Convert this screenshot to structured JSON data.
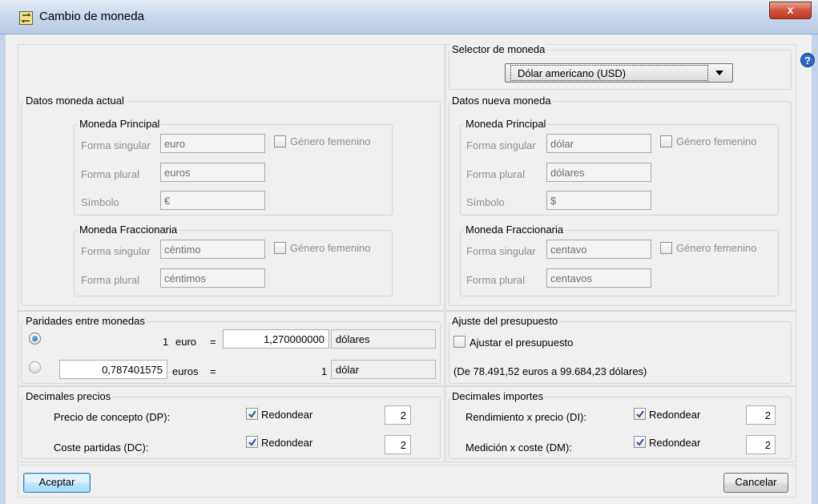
{
  "window": {
    "title": "Cambio de moneda",
    "close_label": "x",
    "help_label": "?"
  },
  "selector": {
    "legend": "Selector de moneda",
    "selected": "Dólar americano (USD)"
  },
  "current": {
    "legend": "Datos moneda actual",
    "principal": {
      "legend": "Moneda Principal",
      "singular_label": "Forma singular",
      "singular_value": "euro",
      "plural_label": "Forma plural",
      "plural_value": "euros",
      "symbol_label": "Símbolo",
      "symbol_value": "€",
      "gender_label": "Género femenino"
    },
    "fraction": {
      "legend": "Moneda Fraccionaria",
      "singular_label": "Forma singular",
      "singular_value": "céntimo",
      "plural_label": "Forma plural",
      "plural_value": "céntimos",
      "gender_label": "Género femenino"
    }
  },
  "new": {
    "legend": "Datos nueva moneda",
    "principal": {
      "legend": "Moneda Principal",
      "singular_label": "Forma singular",
      "singular_value": "dólar",
      "plural_label": "Forma plural",
      "plural_value": "dólares",
      "symbol_label": "Símbolo",
      "symbol_value": "$",
      "gender_label": "Género femenino"
    },
    "fraction": {
      "legend": "Moneda Fraccionaria",
      "singular_label": "Forma singular",
      "singular_value": "centavo",
      "plural_label": "Forma plural",
      "plural_value": "centavos",
      "gender_label": "Género femenino"
    }
  },
  "parity": {
    "legend": "Paridades entre monedas",
    "row1": {
      "amount": "1",
      "currency": "euro",
      "equals": "=",
      "value": "1,270000000",
      "target": "dólares",
      "selected": true
    },
    "row2": {
      "value": "0,787401575",
      "currency": "euros",
      "equals": "=",
      "amount": "1",
      "target": "dólar",
      "selected": false
    }
  },
  "budget": {
    "legend": "Ajuste del presupuesto",
    "checkbox_label": "Ajustar el presupuesto",
    "checked": false,
    "info": "(De 78.491,52 euros a 99.684,23 dólares)"
  },
  "decimals_prices": {
    "legend": "Decimales precios",
    "rows": [
      {
        "label": "Precio de concepto (DP):",
        "round_label": "Redondear",
        "checked": true,
        "value": "2"
      },
      {
        "label": "Coste partidas (DC):",
        "round_label": "Redondear",
        "checked": true,
        "value": "2"
      }
    ]
  },
  "decimals_amounts": {
    "legend": "Decimales importes",
    "rows": [
      {
        "label": "Rendimiento x precio (DI):",
        "round_label": "Redondear",
        "checked": true,
        "value": "2"
      },
      {
        "label": "Medición x coste (DM):",
        "round_label": "Redondear",
        "checked": true,
        "value": "2"
      }
    ]
  },
  "buttons": {
    "accept": "Aceptar",
    "cancel": "Cancelar"
  }
}
